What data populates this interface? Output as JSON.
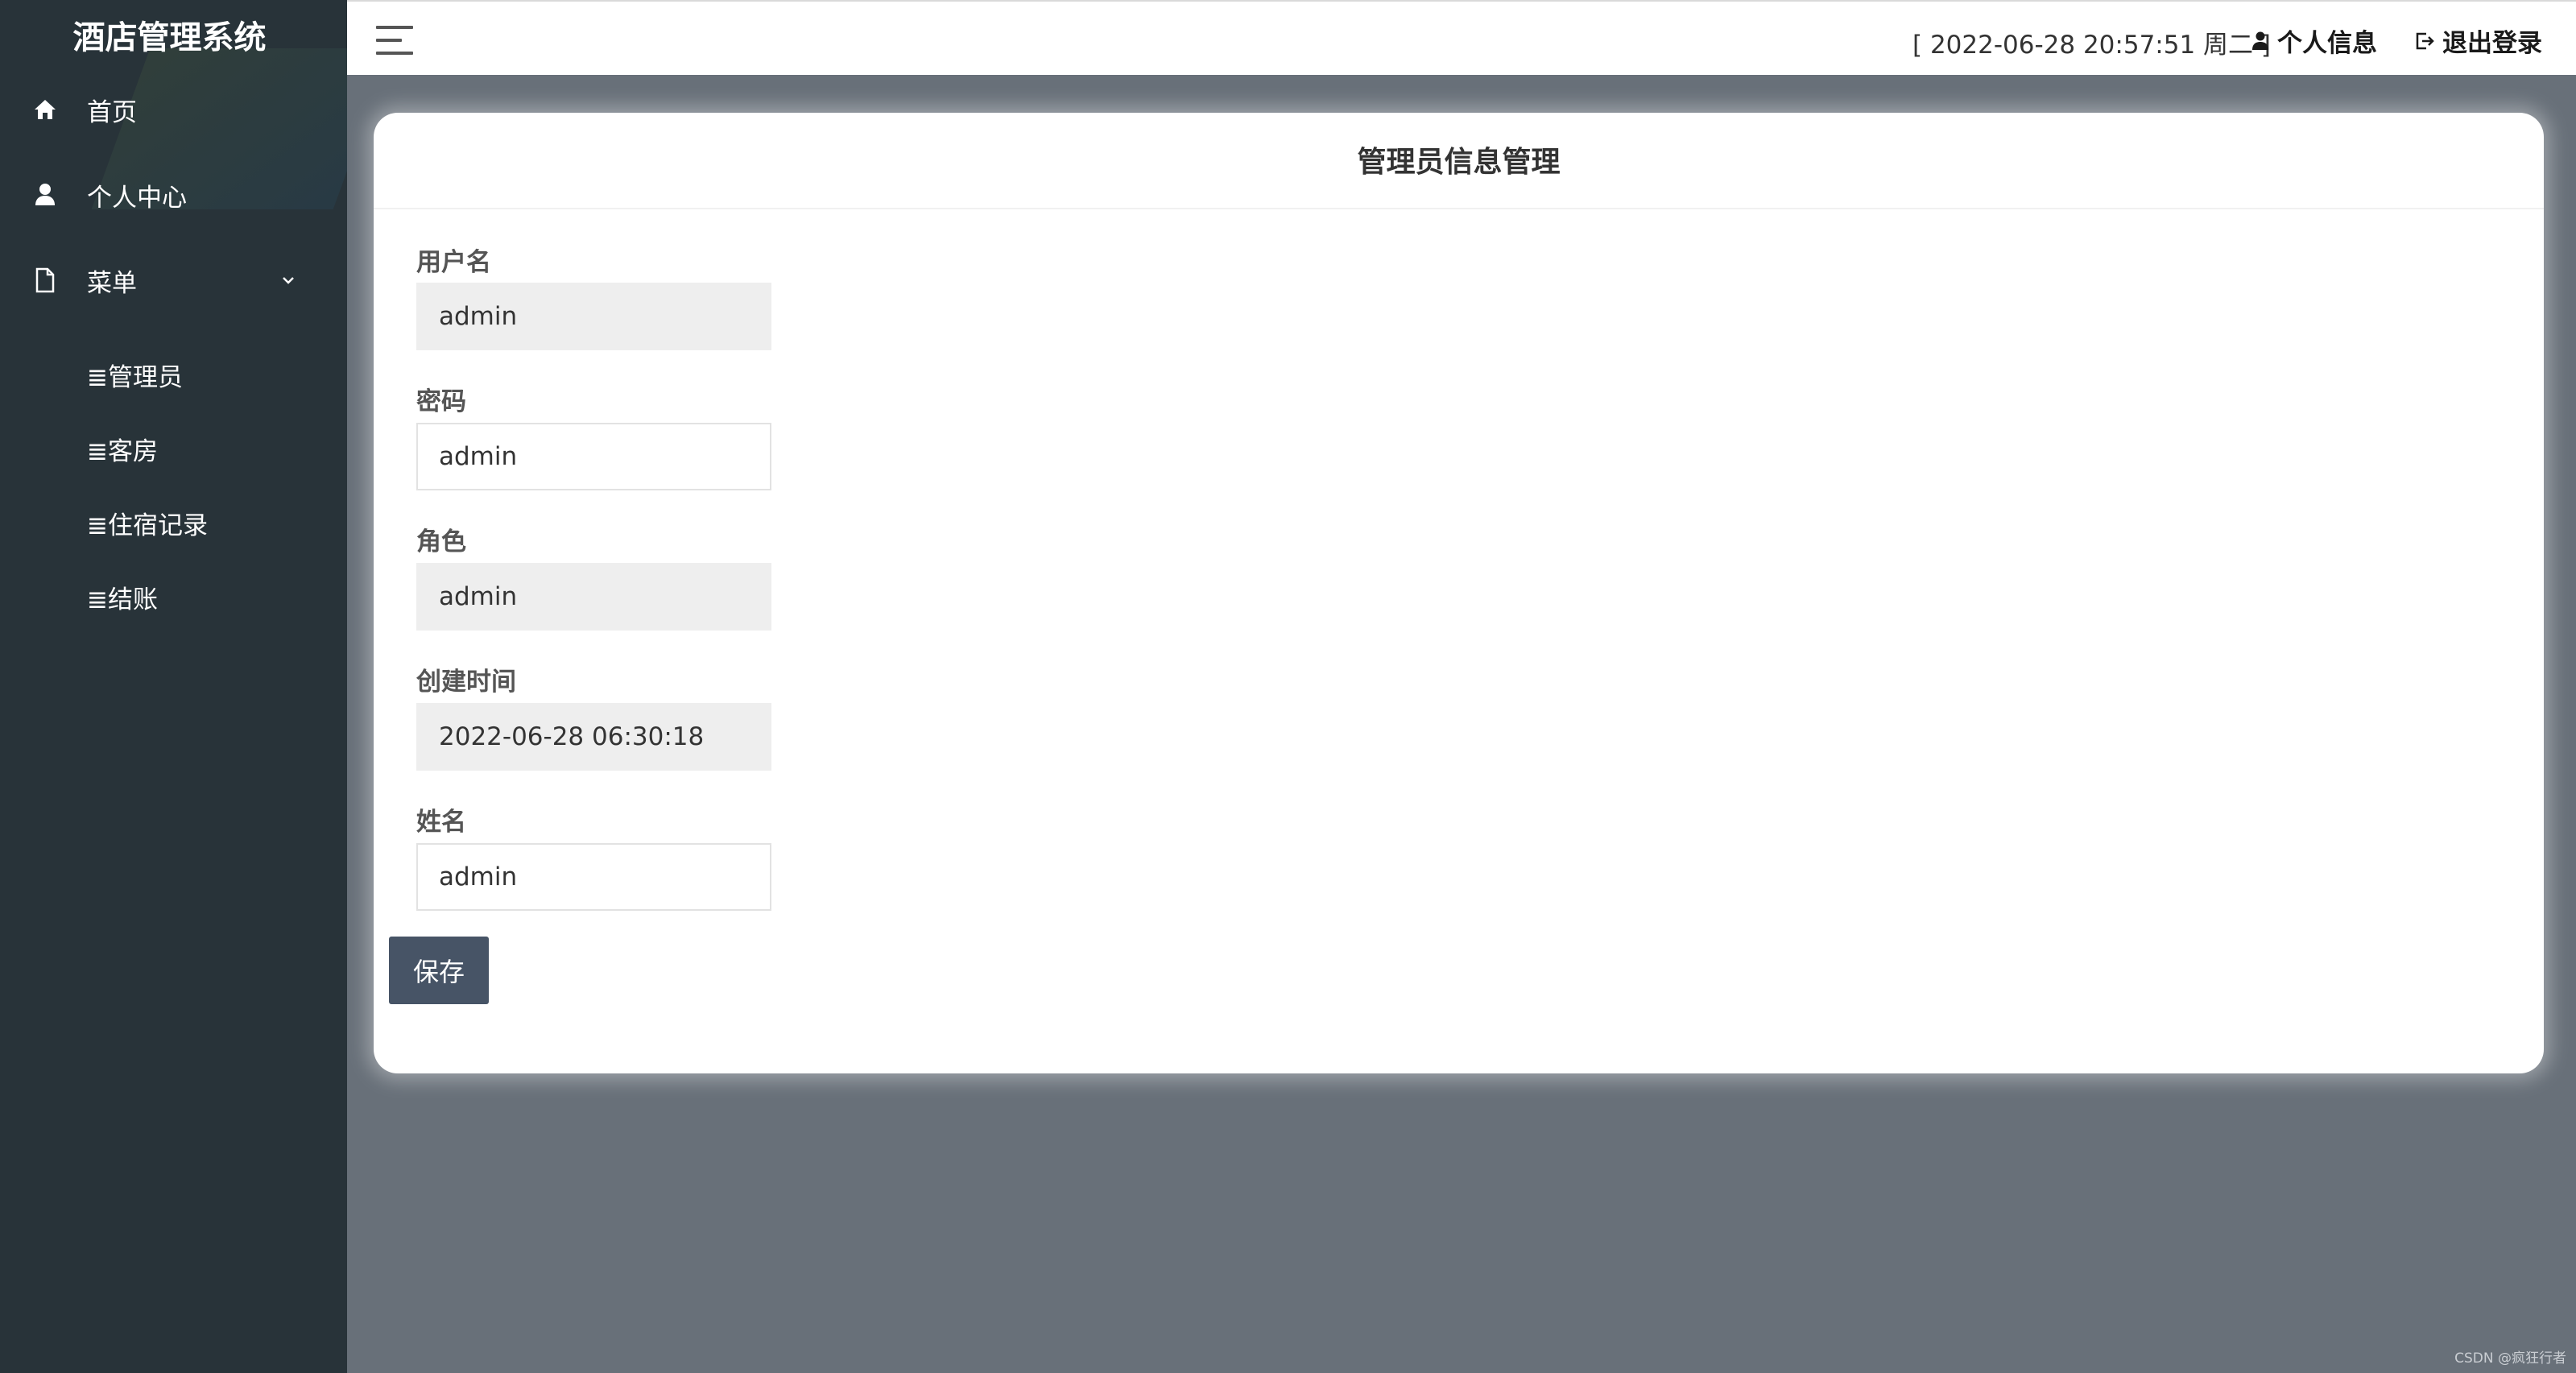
{
  "sidebar": {
    "brand": "酒店管理系统",
    "nav": [
      {
        "label": "首页",
        "icon": "home-icon"
      },
      {
        "label": "个人中心",
        "icon": "user-icon"
      },
      {
        "label": "菜单",
        "icon": "file-icon",
        "expanded": true
      }
    ],
    "submenu": [
      "≣管理员",
      "≣客房",
      "≣住宿记录",
      "≣结账"
    ]
  },
  "header": {
    "menu_icon": "hamburger-icon",
    "datetime": "[ 2022-06-28 20:57:51 周二 ]",
    "profile_label": "个人信息",
    "logout_label": "退出登录"
  },
  "form": {
    "title": "管理员信息管理",
    "username_label": "用户名",
    "username_value": "admin",
    "password_label": "密码",
    "password_value": "admin",
    "role_label": "角色",
    "role_value": "admin",
    "created_label": "创建时间",
    "created_value": "2022-06-28 06:30:18",
    "name_label": "姓名",
    "name_value": "admin",
    "save_label": "保存"
  },
  "watermark": "CSDN @疯狂行者",
  "colors": {
    "sidebar_bg": "#283339",
    "content_bg": "#687079",
    "button_bg": "#475466",
    "readonly_bg": "#eeeeee"
  }
}
